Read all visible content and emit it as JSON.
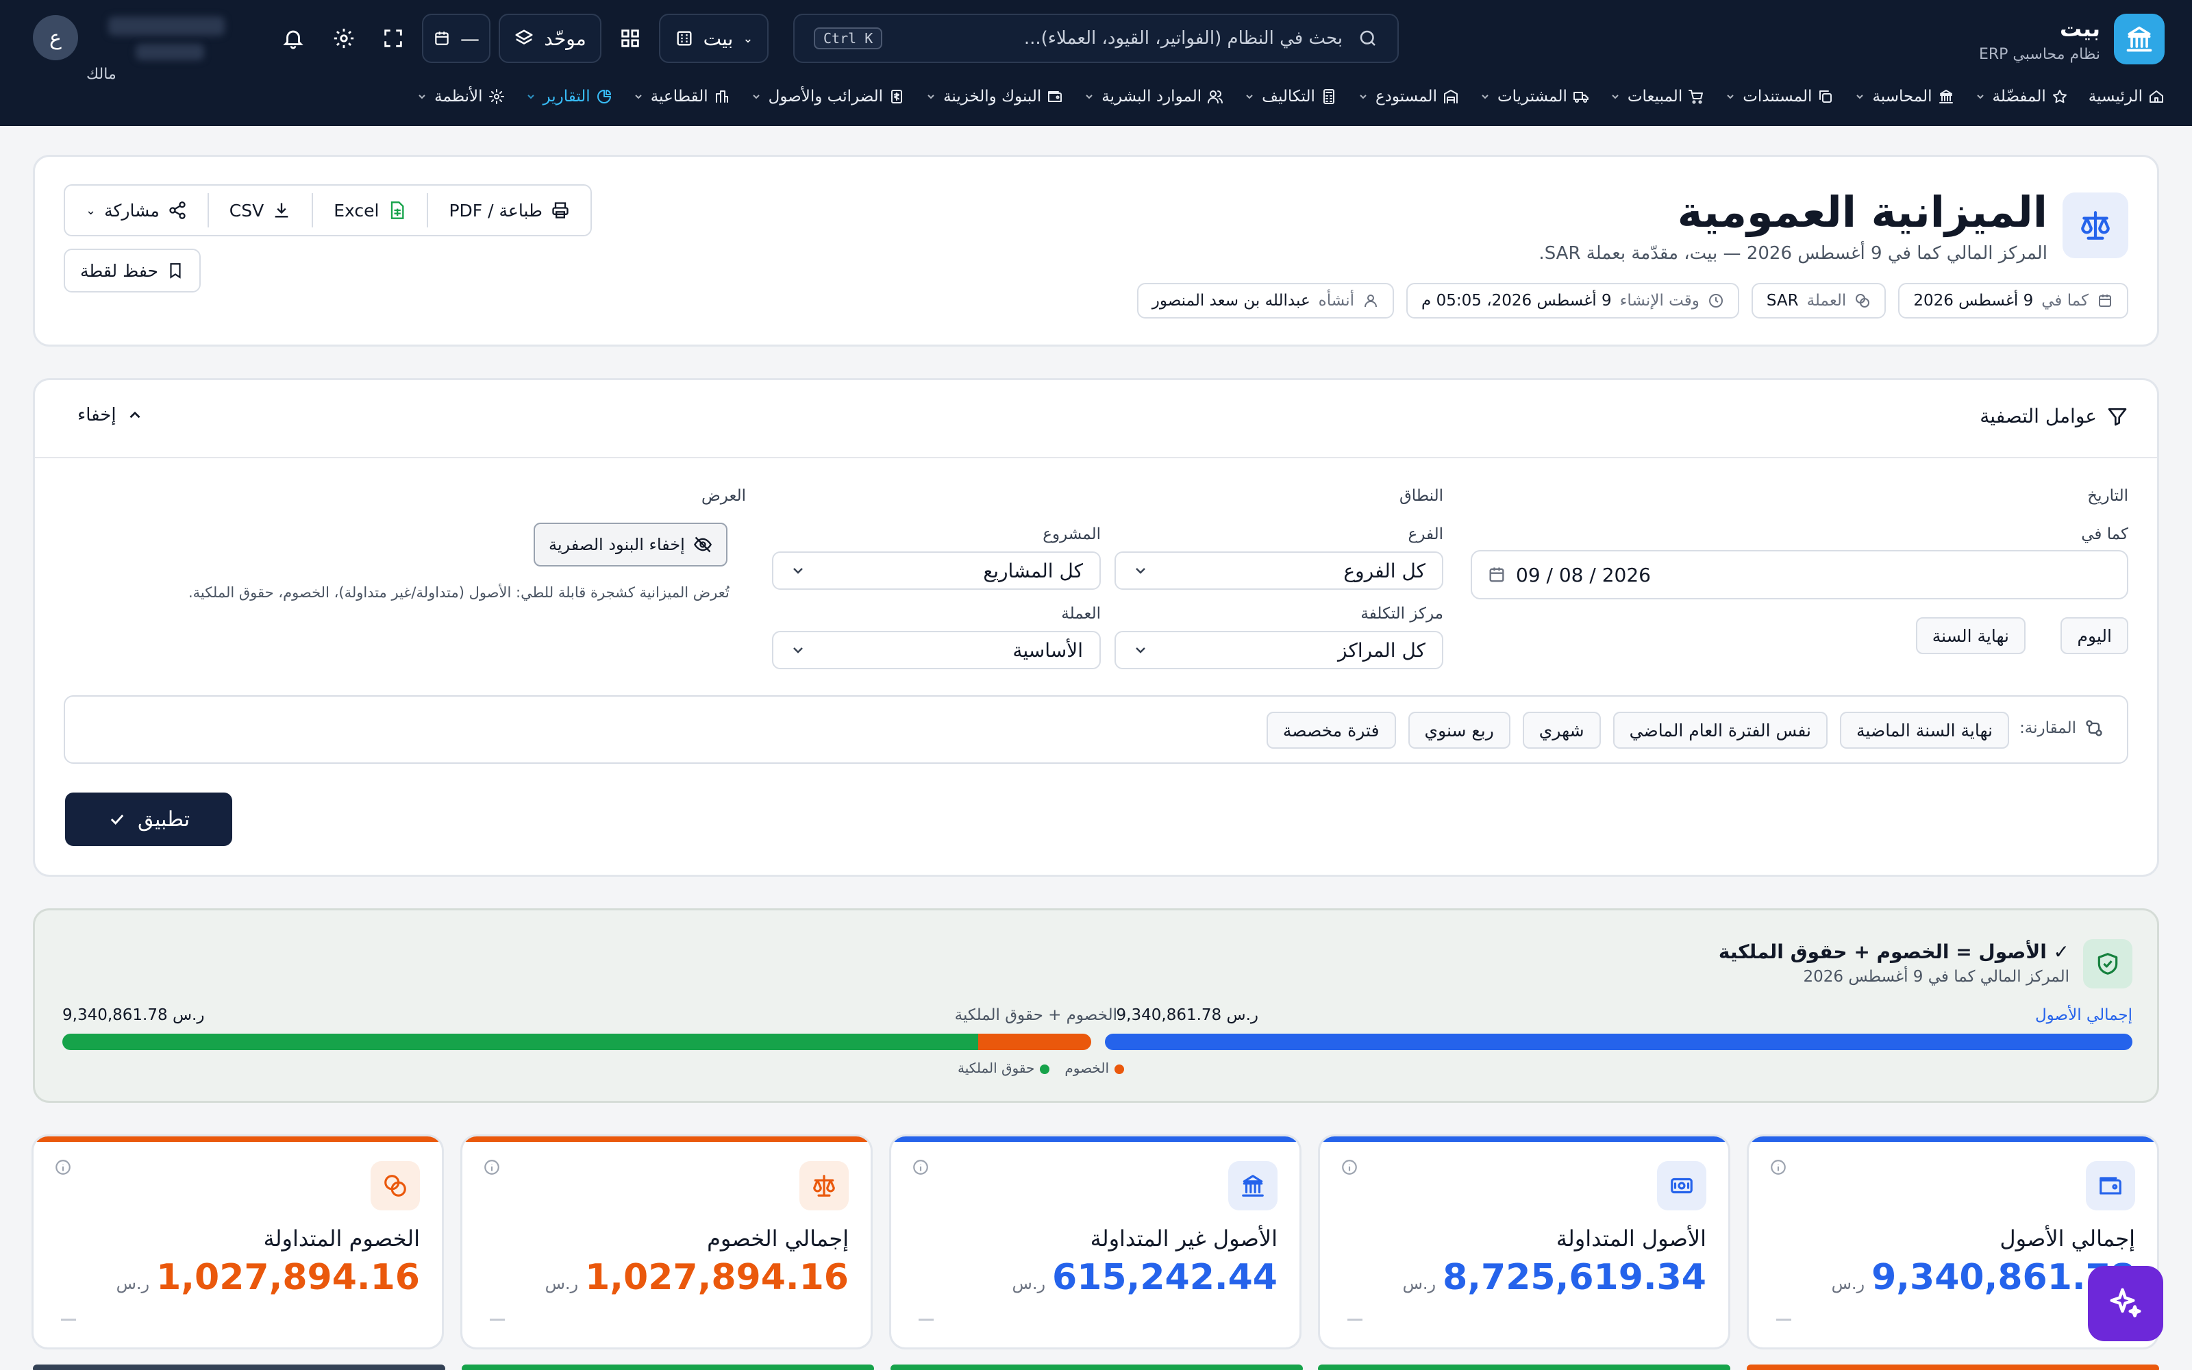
{
  "brand": {
    "title": "بيت",
    "subtitle": "نظام محاسبي ERP"
  },
  "search": {
    "placeholder": "بحث في النظام (الفواتير، القيود، العملاء)...",
    "shortcut": "Ctrl K"
  },
  "org_selector": {
    "label": "بيت"
  },
  "view_mode": {
    "label": "موحّد"
  },
  "date_widget": {
    "label": "—"
  },
  "user": {
    "initial": "ع",
    "role": "مالك"
  },
  "menu": [
    {
      "label": "الرئيسية",
      "icon": "home-icon",
      "has_dropdown": false,
      "active": false
    },
    {
      "label": "المفضّلة",
      "icon": "star-icon",
      "has_dropdown": true,
      "active": false
    },
    {
      "label": "المحاسبة",
      "icon": "bank-icon",
      "has_dropdown": true,
      "active": false
    },
    {
      "label": "المستندات",
      "icon": "copy-icon",
      "has_dropdown": true,
      "active": false
    },
    {
      "label": "المبيعات",
      "icon": "cart-icon",
      "has_dropdown": true,
      "active": false
    },
    {
      "label": "المشتريات",
      "icon": "truck-icon",
      "has_dropdown": true,
      "active": false
    },
    {
      "label": "المستودع",
      "icon": "warehouse-icon",
      "has_dropdown": true,
      "active": false
    },
    {
      "label": "التكاليف",
      "icon": "calculator-icon",
      "has_dropdown": true,
      "active": false
    },
    {
      "label": "الموارد البشرية",
      "icon": "users-icon",
      "has_dropdown": true,
      "active": false
    },
    {
      "label": "البنوك والخزينة",
      "icon": "wallet-icon",
      "has_dropdown": true,
      "active": false
    },
    {
      "label": "الضرائب والأصول",
      "icon": "tax-icon",
      "has_dropdown": true,
      "active": false
    },
    {
      "label": "القطاعية",
      "icon": "segments-icon",
      "has_dropdown": true,
      "active": false
    },
    {
      "label": "التقارير",
      "icon": "pie-chart-icon",
      "has_dropdown": true,
      "active": true
    },
    {
      "label": "الأنظمة",
      "icon": "gear-icon",
      "has_dropdown": true,
      "active": false
    }
  ],
  "report": {
    "title": "الميزانية العمومية",
    "subtitle": "المركز المالي كما في 9 أغسطس 2026 — بيت، مقدّمة بعملة SAR.",
    "chips": [
      {
        "label": "كما في",
        "value": "9 أغسطس 2026",
        "icon": "calendar-icon"
      },
      {
        "label": "العملة",
        "value": "SAR",
        "icon": "coins-icon"
      },
      {
        "label": "وقت الإنشاء",
        "value": "9 أغسطس 2026، 05:05 م",
        "icon": "clock-icon"
      },
      {
        "label": "أنشأه",
        "value": "عبدالله بن سعد المنصور",
        "icon": "user-icon"
      }
    ],
    "actions": {
      "print": "طباعة / PDF",
      "excel": "Excel",
      "csv": "CSV",
      "share": "مشاركة",
      "snapshot": "حفظ لقطة"
    }
  },
  "filters": {
    "title": "عوامل التصفية",
    "hide_label": "إخفاء",
    "date_section": "التاريخ",
    "as_of_label": "كما في",
    "as_of_value": "09 / 08 / 2026",
    "presets": [
      "اليوم",
      "نهاية السنة"
    ],
    "scope_section": "النطاق",
    "branch_label": "الفرع",
    "branch_value": "كل الفروع",
    "cost_center_label": "مركز التكلفة",
    "cost_center_value": "كل المراكز",
    "project_label": "المشروع",
    "project_value": "كل المشاريع",
    "currency_label": "العملة",
    "currency_value": "الأساسية",
    "display_section": "العرض",
    "hide_zero_label": "إخفاء البنود الصفرية",
    "display_hint": "تُعرض الميزانية كشجرة قابلة للطي: الأصول (متداولة/غير متداولة)، الخصوم، حقوق الملكية.",
    "comparison_label": "المقارنة:",
    "comparison_options": [
      "نهاية السنة الماضية",
      "نفس الفترة العام الماضي",
      "شهري",
      "ربع سنوي",
      "فترة مخصصة"
    ],
    "apply_label": "تطبيق"
  },
  "balance_check": {
    "title": "✓ الأصول = الخصوم + حقوق الملكية",
    "subtitle": "المركز المالي كما في 9 أغسطس 2026",
    "assets_label": "إجمالي الأصول",
    "assets_value": "9,340,861.78",
    "currency": "ر.س",
    "le_label": "الخصوم + حقوق الملكية",
    "le_value": "9,340,861.78",
    "liabilities_share": 0.11,
    "equity_share": 0.89,
    "legend": {
      "liabilities": "الخصوم",
      "equity": "حقوق الملكية"
    },
    "colors": {
      "assets": "#2563eb",
      "liabilities": "#ea580c",
      "equity": "#16a34a"
    }
  },
  "kpis": [
    {
      "label": "إجمالي الأصول",
      "value": "9,340,861.78",
      "currency": "ر.س",
      "color": "#2563eb",
      "icon": "wallet-icon"
    },
    {
      "label": "الأصول المتداولة",
      "value": "8,725,619.34",
      "currency": "ر.س",
      "color": "#2563eb",
      "icon": "banknote-icon"
    },
    {
      "label": "الأصول غير المتداولة",
      "value": "615,242.44",
      "currency": "ر.س",
      "color": "#2563eb",
      "icon": "bank-icon"
    },
    {
      "label": "إجمالي الخصوم",
      "value": "1,027,894.16",
      "currency": "ر.س",
      "color": "#ea580c",
      "icon": "scale-icon"
    },
    {
      "label": "الخصوم المتداولة",
      "value": "1,027,894.16",
      "currency": "ر.س",
      "color": "#ea580c",
      "icon": "coins-icon"
    }
  ]
}
